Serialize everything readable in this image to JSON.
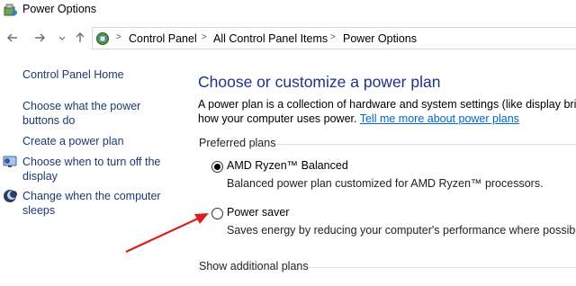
{
  "window": {
    "title": "Power Options"
  },
  "nav": {
    "back_icon": "arrow-left",
    "forward_icon": "arrow-right",
    "recent_icon": "chevron-down",
    "up_icon": "arrow-up"
  },
  "address": {
    "separator": ">",
    "crumbs": [
      "Control Panel",
      "All Control Panel Items",
      "Power Options"
    ]
  },
  "sidebar": {
    "home": "Control Panel Home",
    "items": [
      {
        "line1": "Choose what the power",
        "line2": "buttons do"
      },
      {
        "line1": "Create a power plan"
      },
      {
        "line1": "Choose when to turn off the",
        "line2": "display",
        "icon": "monitor-icon"
      },
      {
        "line1": "Change when the computer",
        "line2": "sleeps",
        "icon": "moon-icon"
      }
    ]
  },
  "main": {
    "heading": "Choose or customize a power plan",
    "desc_line1": "A power plan is a collection of hardware and system settings (like display brightn",
    "desc_line2": "how your computer uses power.",
    "desc_link": "Tell me more about power plans",
    "preferred_label": "Preferred plans",
    "plans": [
      {
        "name": "AMD Ryzen™ Balanced",
        "description": "Balanced power plan customized for AMD Ryzen™ processors.",
        "selected": true
      },
      {
        "name": "Power saver",
        "description": "Saves energy by reducing your computer's performance where possible.",
        "selected": false
      }
    ],
    "show_additional": "Show additional plans"
  },
  "colors": {
    "heading": "#1e3287",
    "sidebar_link": "#1c3a6e",
    "link": "#0066cc",
    "annotation_arrow": "#d92020",
    "separator_line": "#d4dfe9"
  }
}
